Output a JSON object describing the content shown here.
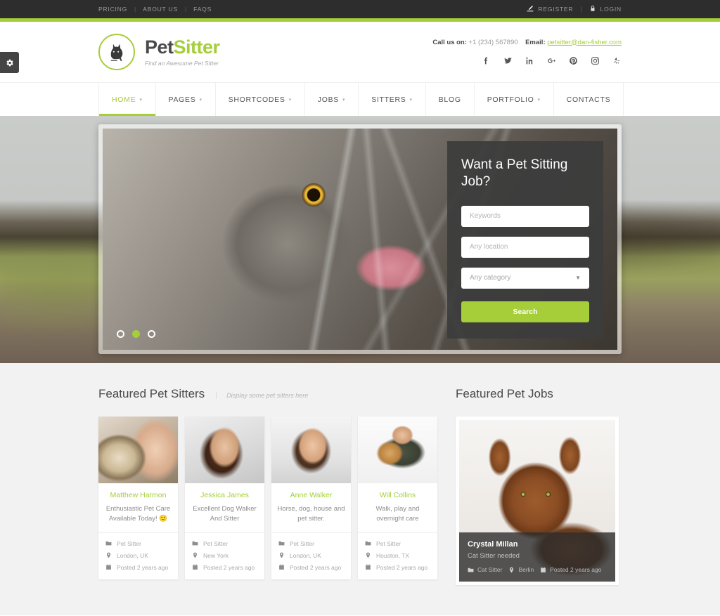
{
  "topbar": {
    "left_links": [
      "Pricing",
      "About Us",
      "FAQs"
    ],
    "separator": "|",
    "register_label": "Register",
    "login_label": "Login",
    "register_icon": "edit-icon",
    "login_icon": "lock-icon"
  },
  "header": {
    "brand_first": "Pet",
    "brand_second": "Sitter",
    "tagline": "Find an Awesome Pet Sitter",
    "logo_icon": "cat-icon",
    "call_label": "Call us on:",
    "phone": "+1 (234) 567890",
    "email_label": "Email:",
    "email": "petsitter@dan-fisher.com",
    "socials": [
      {
        "name": "facebook-icon"
      },
      {
        "name": "twitter-icon"
      },
      {
        "name": "linkedin-icon"
      },
      {
        "name": "googleplus-icon"
      },
      {
        "name": "pinterest-icon"
      },
      {
        "name": "instagram-icon"
      },
      {
        "name": "yelp-icon"
      }
    ]
  },
  "nav": {
    "items": [
      {
        "label": "Home",
        "caret": true,
        "active": true
      },
      {
        "label": "Pages",
        "caret": true,
        "active": false
      },
      {
        "label": "Shortcodes",
        "caret": true,
        "active": false
      },
      {
        "label": "Jobs",
        "caret": true,
        "active": false
      },
      {
        "label": "Sitters",
        "caret": true,
        "active": false
      },
      {
        "label": "Blog",
        "caret": false,
        "active": false
      },
      {
        "label": "Portfolio",
        "caret": true,
        "active": false
      },
      {
        "label": "Contacts",
        "caret": false,
        "active": false
      }
    ]
  },
  "hero": {
    "slide_alt": "close-up of a grey tabby cat licking its nose",
    "dots": [
      {
        "active": false
      },
      {
        "active": true
      },
      {
        "active": false
      }
    ],
    "search": {
      "title": "Want a Pet Sitting Job?",
      "keywords_value": "",
      "keywords_placeholder": "Keywords",
      "location_value": "",
      "location_placeholder": "Any location",
      "category_value": "Any category",
      "search_button": "Search"
    }
  },
  "featured": {
    "sitters": {
      "title": "Featured Pet Sitters",
      "subtitle": "Display some pet sitters here",
      "cards": [
        {
          "name": "Matthew Harmon",
          "desc": "Enthusiastic Pet Care Available Today! 🙂",
          "role": "Pet Sitter",
          "location": "London, UK",
          "posted": "Posted 2 years ago",
          "photo_alt": "woman hugging a golden retriever"
        },
        {
          "name": "Jessica James",
          "desc": "Excellent Dog Walker And Sitter",
          "role": "Pet Sitter",
          "location": "New York",
          "posted": "Posted 2 years ago",
          "photo_alt": "smiling woman with long curly brown hair"
        },
        {
          "name": "Anne Walker",
          "desc": "Horse, dog, house and pet sitter.",
          "role": "Pet Sitter",
          "location": "London, UK",
          "posted": "Posted 2 years ago",
          "photo_alt": "smiling woman in a white shirt"
        },
        {
          "name": "Will Collins",
          "desc": "Walk, play and overnight care",
          "role": "Pet Sitter",
          "location": "Houston, TX",
          "posted": "Posted 2 years ago",
          "photo_alt": "man sitting cross-legged holding a dog"
        }
      ]
    },
    "jobs": {
      "title": "Featured Pet Jobs",
      "card": {
        "title": "Crystal Millan",
        "subtitle": "Cat Sitter needed",
        "role": "Cat Sitter",
        "location": "Berlin",
        "posted": "Posted 2 years ago",
        "photo_alt": "abyssinian cat lying down on a white background"
      }
    }
  },
  "settings_tab": {
    "icon": "gear-icon"
  },
  "colors": {
    "accent_green": "#a5ce39",
    "topbar_dark": "#2d2d2d",
    "panel_dark": "#3c3c3c",
    "section_bg": "#f2f2f2"
  }
}
